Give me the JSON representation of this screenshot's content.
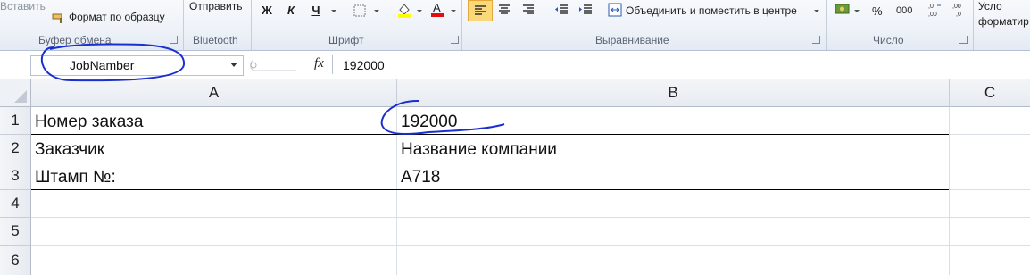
{
  "ribbon": {
    "clipboard": {
      "paste_label": "Вставить",
      "format_painter_label": "Формат по образцу",
      "group_label": "Буфер обмена"
    },
    "bluetooth": {
      "send_label": "Отправить",
      "group_label": "Bluetooth"
    },
    "font": {
      "bold": "Ж",
      "italic": "К",
      "underline": "Ч",
      "group_label": "Шрифт",
      "highlight_color": "#ffff00",
      "font_color": "#e01010"
    },
    "alignment": {
      "merge_label": "Объединить и поместить в центре",
      "group_label": "Выравнивание"
    },
    "number": {
      "percent": "%",
      "thousands": "000",
      "group_label": "Число"
    },
    "styles": {
      "cond_format_label_1": "Усло",
      "cond_format_label_2": "форматир"
    }
  },
  "formula_bar": {
    "name_box": "JobNamber",
    "fx_label": "fx",
    "formula_value": "192000"
  },
  "sheet": {
    "columns": [
      "A",
      "B",
      "C"
    ],
    "rows": [
      "1",
      "2",
      "3",
      "4",
      "5",
      "6"
    ],
    "cells": {
      "A1": "Номер заказа",
      "B1": "192000",
      "A2": "Заказчик",
      "B2": "Название компании",
      "A3": "Штамп №:",
      "B3": "А718"
    }
  },
  "annotation_color": "#1a2fd0"
}
